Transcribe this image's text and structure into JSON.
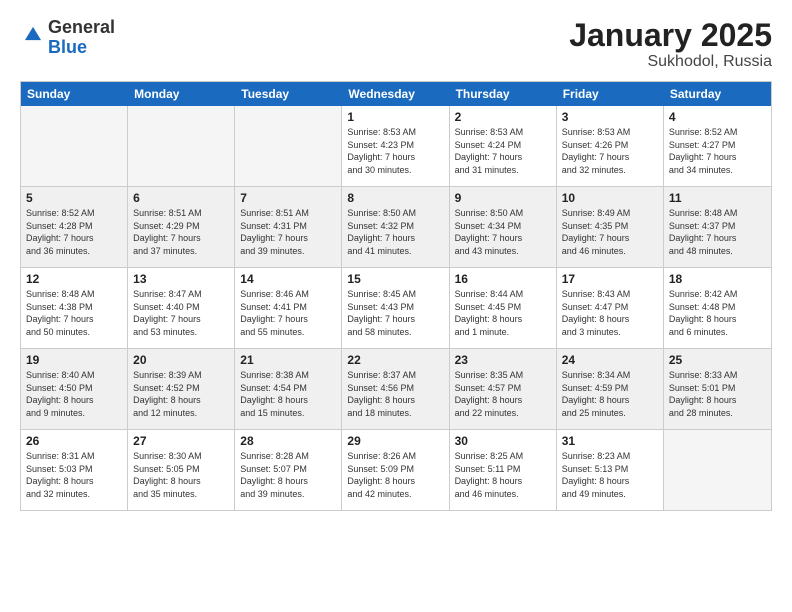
{
  "logo": {
    "general": "General",
    "blue": "Blue"
  },
  "title": "January 2025",
  "location": "Sukhodol, Russia",
  "days_of_week": [
    "Sunday",
    "Monday",
    "Tuesday",
    "Wednesday",
    "Thursday",
    "Friday",
    "Saturday"
  ],
  "weeks": [
    [
      {
        "day": "",
        "info": "",
        "empty": true
      },
      {
        "day": "",
        "info": "",
        "empty": true
      },
      {
        "day": "",
        "info": "",
        "empty": true
      },
      {
        "day": "1",
        "info": "Sunrise: 8:53 AM\nSunset: 4:23 PM\nDaylight: 7 hours\nand 30 minutes."
      },
      {
        "day": "2",
        "info": "Sunrise: 8:53 AM\nSunset: 4:24 PM\nDaylight: 7 hours\nand 31 minutes."
      },
      {
        "day": "3",
        "info": "Sunrise: 8:53 AM\nSunset: 4:26 PM\nDaylight: 7 hours\nand 32 minutes."
      },
      {
        "day": "4",
        "info": "Sunrise: 8:52 AM\nSunset: 4:27 PM\nDaylight: 7 hours\nand 34 minutes."
      }
    ],
    [
      {
        "day": "5",
        "info": "Sunrise: 8:52 AM\nSunset: 4:28 PM\nDaylight: 7 hours\nand 36 minutes.",
        "shaded": true
      },
      {
        "day": "6",
        "info": "Sunrise: 8:51 AM\nSunset: 4:29 PM\nDaylight: 7 hours\nand 37 minutes.",
        "shaded": true
      },
      {
        "day": "7",
        "info": "Sunrise: 8:51 AM\nSunset: 4:31 PM\nDaylight: 7 hours\nand 39 minutes.",
        "shaded": true
      },
      {
        "day": "8",
        "info": "Sunrise: 8:50 AM\nSunset: 4:32 PM\nDaylight: 7 hours\nand 41 minutes.",
        "shaded": true
      },
      {
        "day": "9",
        "info": "Sunrise: 8:50 AM\nSunset: 4:34 PM\nDaylight: 7 hours\nand 43 minutes.",
        "shaded": true
      },
      {
        "day": "10",
        "info": "Sunrise: 8:49 AM\nSunset: 4:35 PM\nDaylight: 7 hours\nand 46 minutes.",
        "shaded": true
      },
      {
        "day": "11",
        "info": "Sunrise: 8:48 AM\nSunset: 4:37 PM\nDaylight: 7 hours\nand 48 minutes.",
        "shaded": true
      }
    ],
    [
      {
        "day": "12",
        "info": "Sunrise: 8:48 AM\nSunset: 4:38 PM\nDaylight: 7 hours\nand 50 minutes."
      },
      {
        "day": "13",
        "info": "Sunrise: 8:47 AM\nSunset: 4:40 PM\nDaylight: 7 hours\nand 53 minutes."
      },
      {
        "day": "14",
        "info": "Sunrise: 8:46 AM\nSunset: 4:41 PM\nDaylight: 7 hours\nand 55 minutes."
      },
      {
        "day": "15",
        "info": "Sunrise: 8:45 AM\nSunset: 4:43 PM\nDaylight: 7 hours\nand 58 minutes."
      },
      {
        "day": "16",
        "info": "Sunrise: 8:44 AM\nSunset: 4:45 PM\nDaylight: 8 hours\nand 1 minute."
      },
      {
        "day": "17",
        "info": "Sunrise: 8:43 AM\nSunset: 4:47 PM\nDaylight: 8 hours\nand 3 minutes."
      },
      {
        "day": "18",
        "info": "Sunrise: 8:42 AM\nSunset: 4:48 PM\nDaylight: 8 hours\nand 6 minutes."
      }
    ],
    [
      {
        "day": "19",
        "info": "Sunrise: 8:40 AM\nSunset: 4:50 PM\nDaylight: 8 hours\nand 9 minutes.",
        "shaded": true
      },
      {
        "day": "20",
        "info": "Sunrise: 8:39 AM\nSunset: 4:52 PM\nDaylight: 8 hours\nand 12 minutes.",
        "shaded": true
      },
      {
        "day": "21",
        "info": "Sunrise: 8:38 AM\nSunset: 4:54 PM\nDaylight: 8 hours\nand 15 minutes.",
        "shaded": true
      },
      {
        "day": "22",
        "info": "Sunrise: 8:37 AM\nSunset: 4:56 PM\nDaylight: 8 hours\nand 18 minutes.",
        "shaded": true
      },
      {
        "day": "23",
        "info": "Sunrise: 8:35 AM\nSunset: 4:57 PM\nDaylight: 8 hours\nand 22 minutes.",
        "shaded": true
      },
      {
        "day": "24",
        "info": "Sunrise: 8:34 AM\nSunset: 4:59 PM\nDaylight: 8 hours\nand 25 minutes.",
        "shaded": true
      },
      {
        "day": "25",
        "info": "Sunrise: 8:33 AM\nSunset: 5:01 PM\nDaylight: 8 hours\nand 28 minutes.",
        "shaded": true
      }
    ],
    [
      {
        "day": "26",
        "info": "Sunrise: 8:31 AM\nSunset: 5:03 PM\nDaylight: 8 hours\nand 32 minutes."
      },
      {
        "day": "27",
        "info": "Sunrise: 8:30 AM\nSunset: 5:05 PM\nDaylight: 8 hours\nand 35 minutes."
      },
      {
        "day": "28",
        "info": "Sunrise: 8:28 AM\nSunset: 5:07 PM\nDaylight: 8 hours\nand 39 minutes."
      },
      {
        "day": "29",
        "info": "Sunrise: 8:26 AM\nSunset: 5:09 PM\nDaylight: 8 hours\nand 42 minutes."
      },
      {
        "day": "30",
        "info": "Sunrise: 8:25 AM\nSunset: 5:11 PM\nDaylight: 8 hours\nand 46 minutes."
      },
      {
        "day": "31",
        "info": "Sunrise: 8:23 AM\nSunset: 5:13 PM\nDaylight: 8 hours\nand 49 minutes."
      },
      {
        "day": "",
        "info": "",
        "empty": true
      }
    ]
  ]
}
